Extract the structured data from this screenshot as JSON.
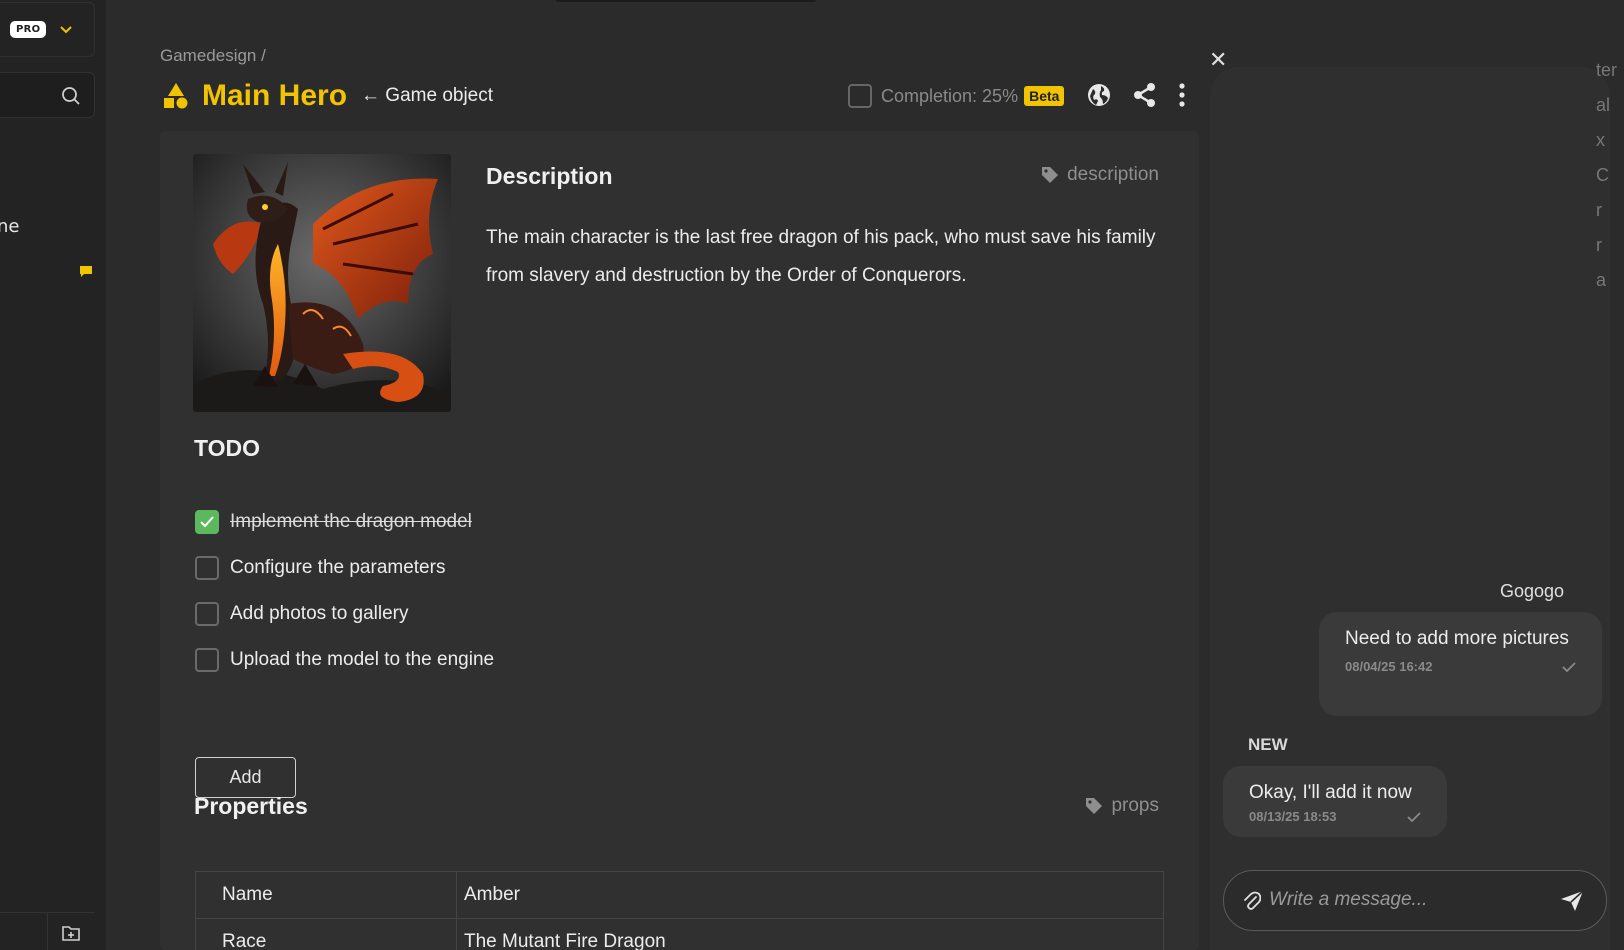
{
  "sidebar": {
    "pro_badge": "PRO",
    "partial_item_text": "ne"
  },
  "header": {
    "breadcrumb": "Gamedesign /",
    "title": "Main Hero",
    "back_link": "← Game object",
    "completion_label": "Completion: 25%",
    "beta_badge": "Beta"
  },
  "description": {
    "heading": "Description",
    "tag": "description",
    "text": "The main character is the last free dragon of his pack, who must save his family from slavery and destruction by the Order of Conquerors."
  },
  "todo": {
    "heading": "TODO",
    "items": [
      {
        "label": "Implement the dragon model",
        "done": true
      },
      {
        "label": "Configure the parameters",
        "done": false
      },
      {
        "label": "Add photos to gallery",
        "done": false
      },
      {
        "label": "Upload the model to the engine",
        "done": false
      }
    ],
    "add_label": "Add"
  },
  "properties": {
    "heading": "Properties",
    "tag": "props",
    "rows": [
      {
        "key": "Name",
        "value": "Amber"
      },
      {
        "key": "Race",
        "value": "The Mutant Fire Dragon"
      }
    ]
  },
  "chat": {
    "author": "Gogogo",
    "messages": [
      {
        "text": "Need to add more pictures",
        "time": "08/04/25 16:42"
      },
      {
        "text": "Okay, I'll add it now",
        "time": "08/13/25 18:53"
      }
    ],
    "new_label": "NEW",
    "input_placeholder": "Write a message..."
  },
  "right_edge_fragments": [
    "ter",
    "al",
    "x",
    "C",
    "r",
    "r",
    "a"
  ],
  "colors": {
    "accent": "#f2c300",
    "done_green": "#5cb85c",
    "background": "#2b2b2b",
    "card": "#303030"
  }
}
